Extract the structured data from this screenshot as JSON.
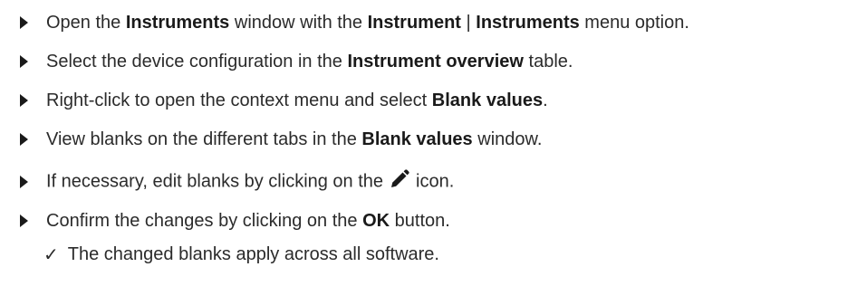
{
  "steps": [
    {
      "parts": [
        "Open the ",
        "Instruments",
        " window with the ",
        "Instrument",
        " | ",
        "Instruments",
        " menu option."
      ]
    },
    {
      "parts": [
        "Select the device configuration in the ",
        "Instrument overview",
        " table."
      ]
    },
    {
      "parts": [
        "Right-click to open the context menu and select ",
        "Blank values",
        "."
      ]
    },
    {
      "parts": [
        "View blanks on the different tabs in the ",
        "Blank values",
        " window."
      ]
    },
    {
      "parts": [
        "If necessary, edit blanks by clicking on the",
        "icon."
      ],
      "icon": "pencil-icon"
    },
    {
      "parts": [
        "Confirm the changes by clicking on the ",
        "OK",
        " button."
      ]
    }
  ],
  "result": {
    "check_symbol": "✓",
    "text": "The changed blanks apply across all software."
  }
}
